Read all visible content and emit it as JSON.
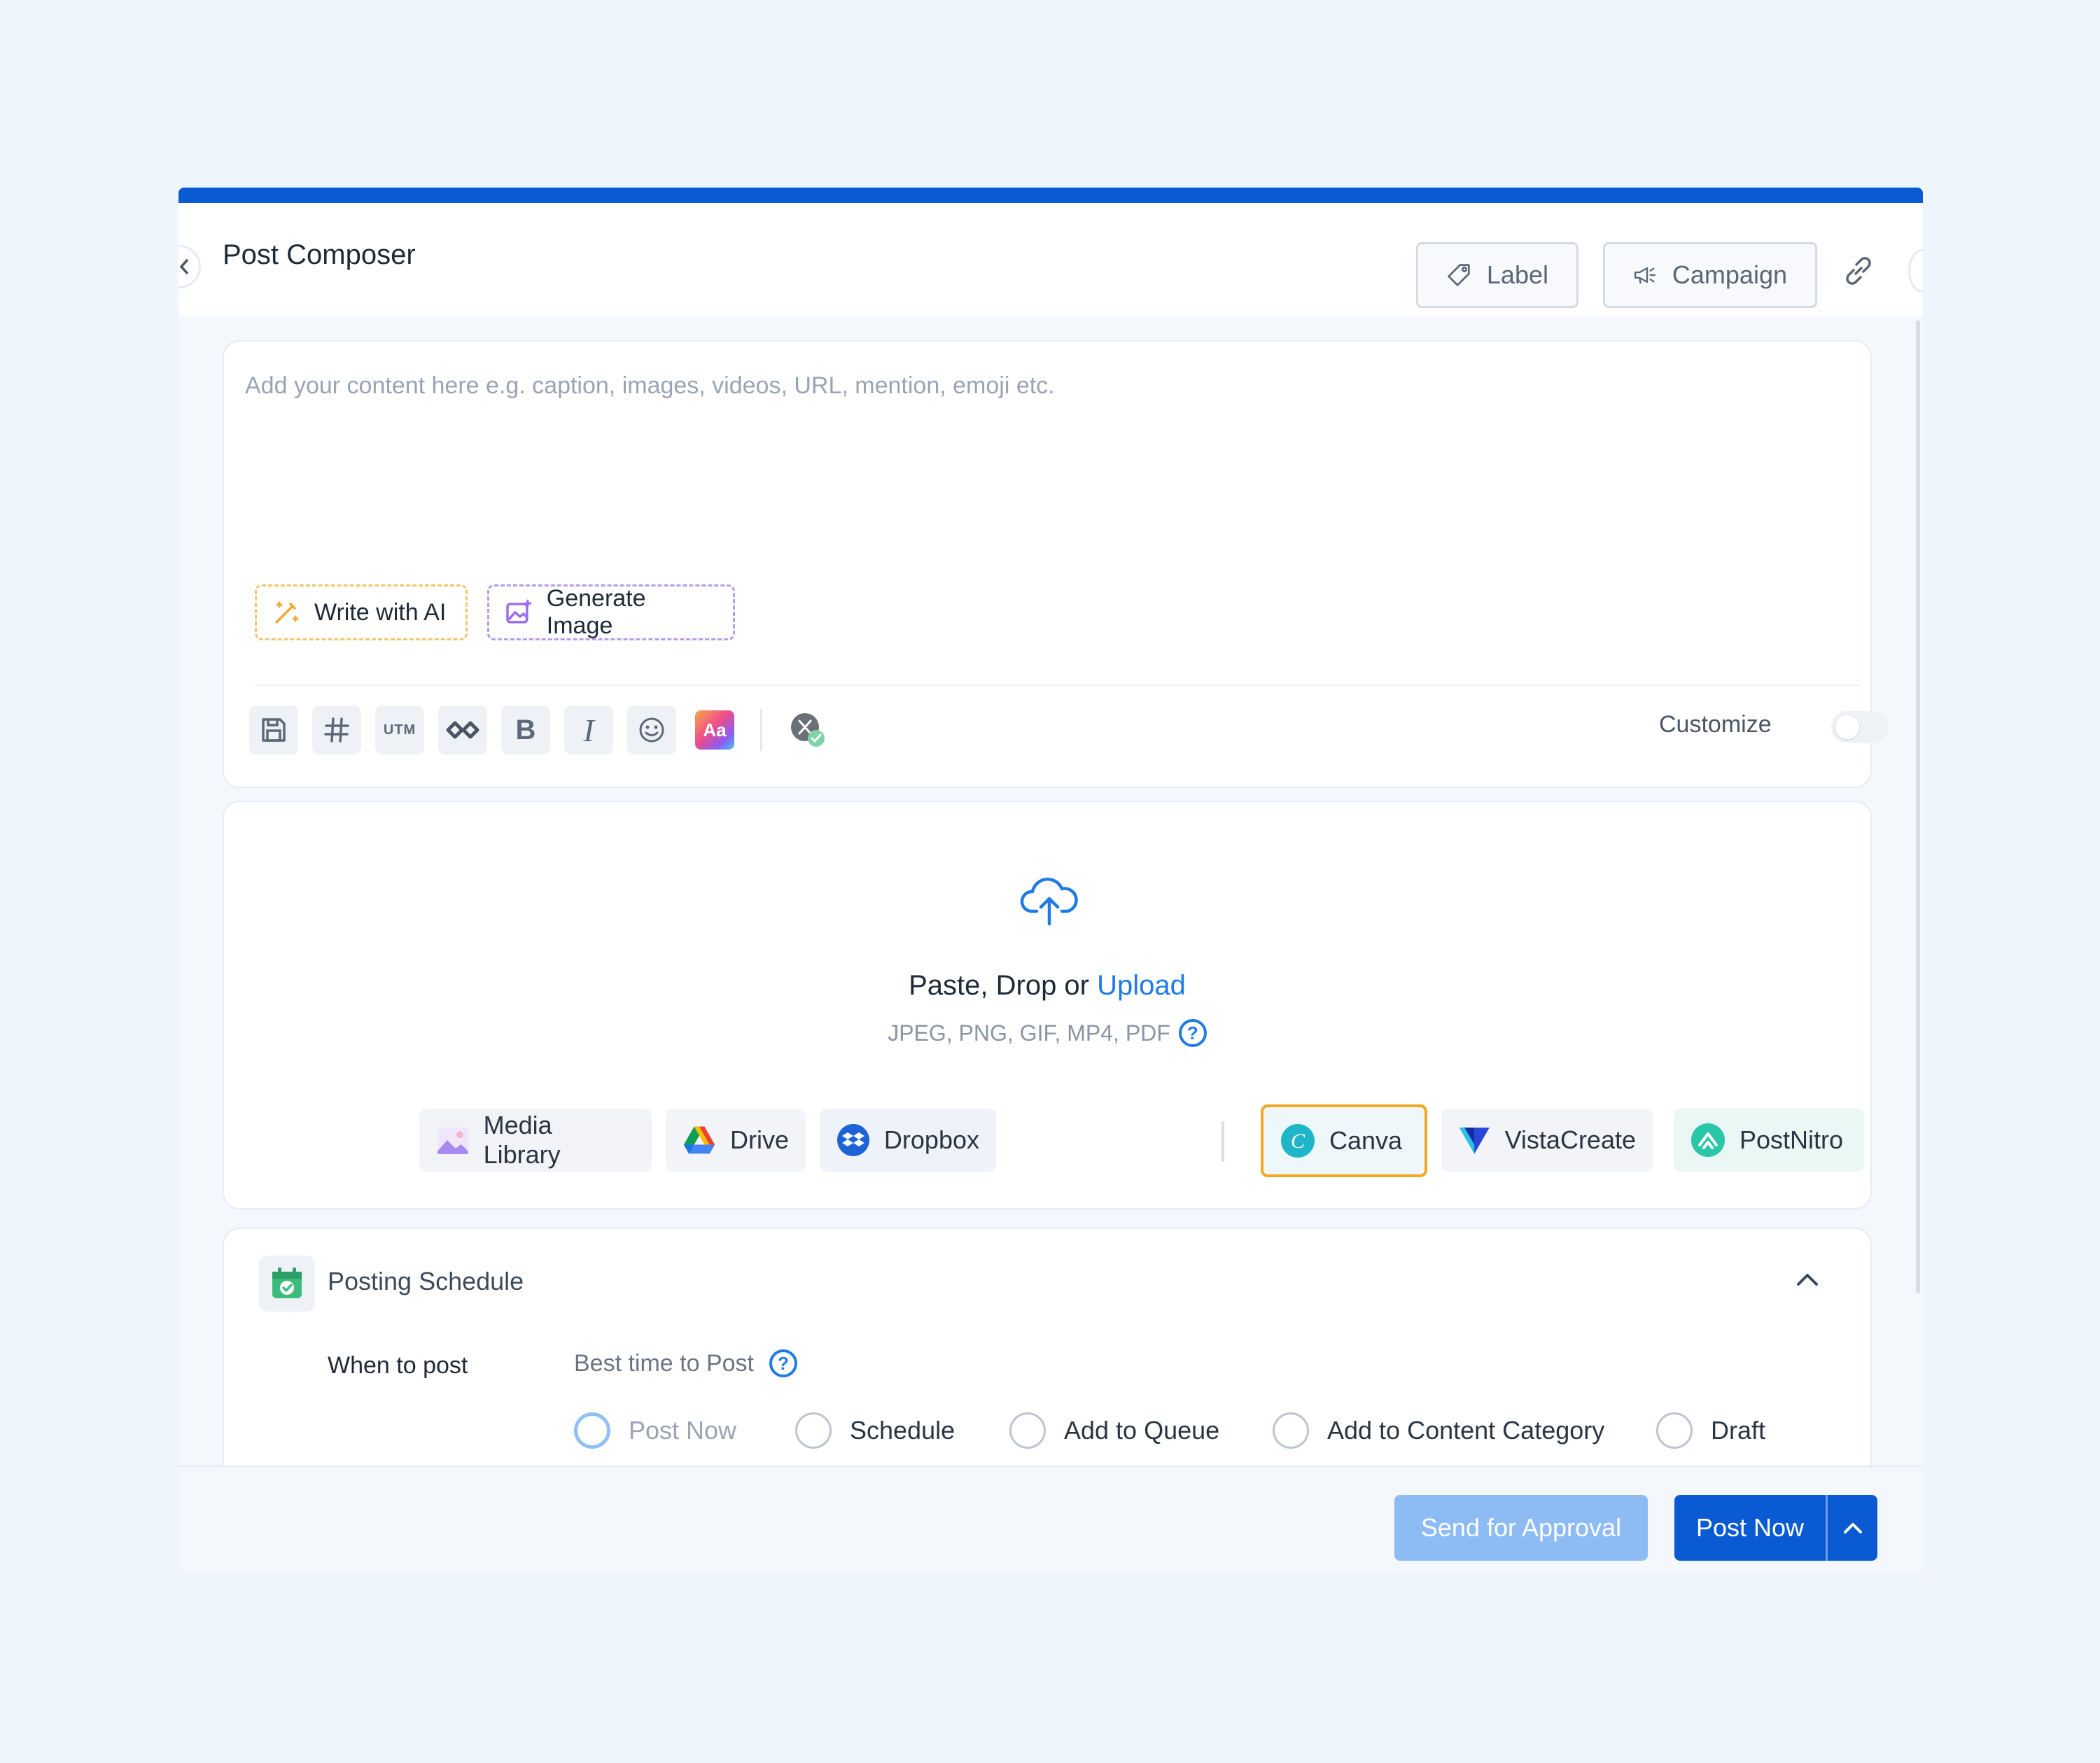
{
  "header": {
    "title": "Post Composer",
    "label_button": "Label",
    "campaign_button": "Campaign"
  },
  "editor": {
    "placeholder": "Add your content here e.g. caption, images, videos, URL, mention, emoji etc.",
    "write_ai": "Write with AI",
    "generate_image": "Generate Image",
    "toolbar": {
      "utm": "UTM",
      "bold": "B",
      "italic": "I",
      "font": "Aa"
    },
    "customize_label": "Customize",
    "customize_enabled": false
  },
  "upload": {
    "title_prefix": "Paste, Drop or ",
    "title_link": "Upload",
    "formats": "JPEG, PNG, GIF, MP4, PDF",
    "sources": {
      "media_library": "Media Library",
      "drive": "Drive",
      "dropbox": "Dropbox",
      "canva": "Canva",
      "vistacreate": "VistaCreate",
      "postnitro": "PostNitro"
    }
  },
  "schedule": {
    "title": "Posting Schedule",
    "when_label": "When to post",
    "best_time": "Best time to Post",
    "options": [
      "Post Now",
      "Schedule",
      "Add to Queue",
      "Add to Content Category",
      "Draft"
    ],
    "selected": "Post Now"
  },
  "footer": {
    "approval_button": "Send for Approval",
    "post_button": "Post Now"
  },
  "colors": {
    "primary": "#0a5bd3",
    "approval": "#8dbbf4",
    "canva_border": "#f5a623"
  }
}
